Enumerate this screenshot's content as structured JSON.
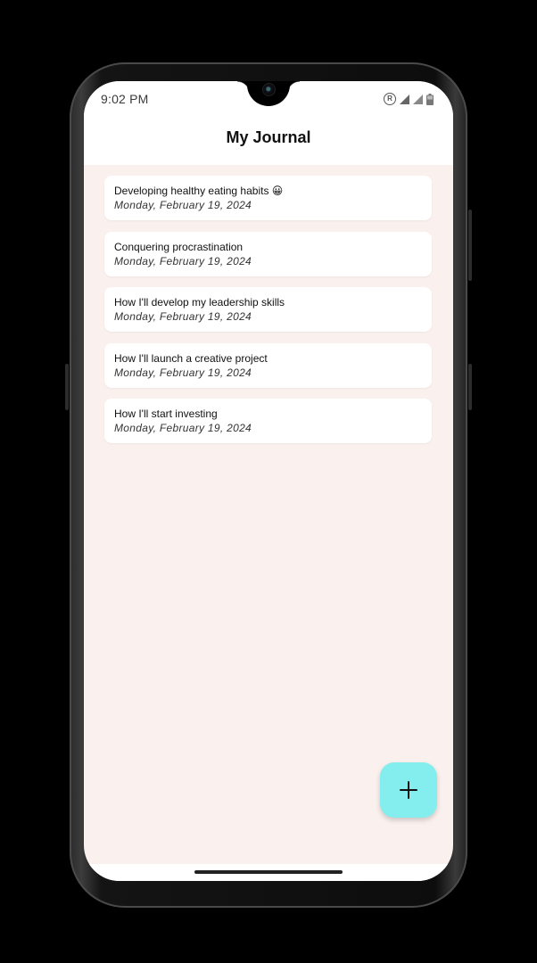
{
  "status_bar": {
    "time": "9:02 PM",
    "icons": [
      "registered-icon",
      "signal-icon",
      "signal-icon",
      "battery-icon"
    ]
  },
  "header": {
    "title": "My Journal"
  },
  "entries": [
    {
      "title": "Developing healthy eating habits 😀",
      "date": "Monday, February 19, 2024"
    },
    {
      "title": "Conquering procrastination",
      "date": "Monday, February 19, 2024"
    },
    {
      "title": "How I'll develop my leadership skills",
      "date": "Monday, February 19, 2024"
    },
    {
      "title": "How I'll launch a creative project",
      "date": "Monday, February 19, 2024"
    },
    {
      "title": "How I'll start investing",
      "date": "Monday, February 19, 2024"
    }
  ],
  "fab": {
    "icon": "plus-icon",
    "color": "#84eeee"
  },
  "colors": {
    "background": "#faf0ee",
    "card": "#ffffff",
    "accent": "#84eeee"
  }
}
